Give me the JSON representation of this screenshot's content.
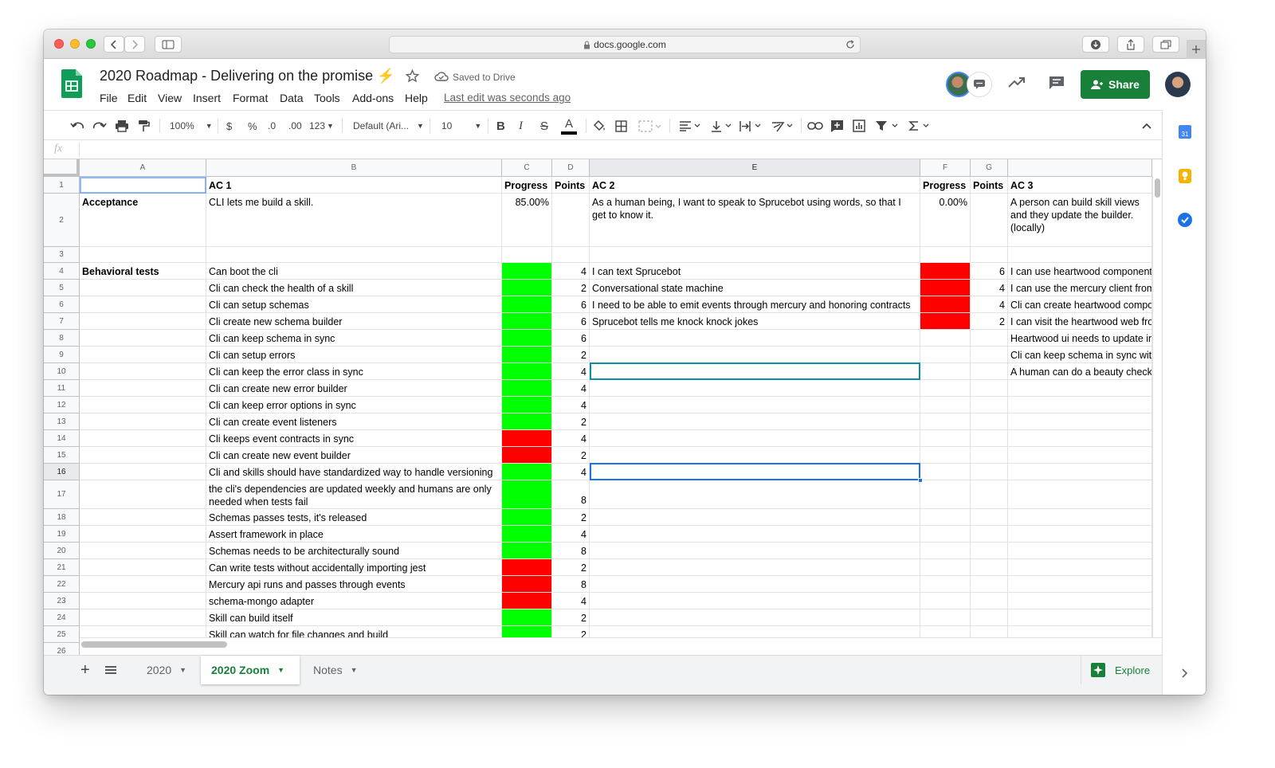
{
  "browser": {
    "url": "docs.google.com"
  },
  "doc": {
    "title": "2020 Roadmap - Delivering on the promise",
    "saved": "Saved to Drive",
    "last_edit": "Last edit was seconds ago",
    "share": "Share",
    "menus": [
      "File",
      "Edit",
      "View",
      "Insert",
      "Format",
      "Data",
      "Tools",
      "Add-ons",
      "Help"
    ]
  },
  "toolbar": {
    "zoom": "100%",
    "currency": "$",
    "percent": "%",
    "dec_minus": ".0",
    "dec_plus": ".00",
    "numfmt": "123",
    "font": "Default (Ari...",
    "size": "10",
    "bold": "B",
    "italic": "I",
    "strike": "S",
    "textcolor": "A"
  },
  "formula": {
    "fx": "fx"
  },
  "columns": [
    "A",
    "B",
    "C",
    "D",
    "E",
    "F",
    "G"
  ],
  "rows": [
    "1",
    "2",
    "3",
    "4",
    "5",
    "6",
    "7",
    "8",
    "9",
    "10",
    "11",
    "12",
    "13",
    "14",
    "15",
    "16",
    "17",
    "18",
    "19",
    "20",
    "21",
    "22",
    "23",
    "24",
    "25",
    "26"
  ],
  "sheet": {
    "header": {
      "b": "AC 1",
      "c": "Progress",
      "d": "Points",
      "e": "AC 2",
      "f": "Progress",
      "g": "Points",
      "h": "AC 3"
    },
    "acceptance": {
      "a": "Acceptance",
      "b": "CLI lets me build a skill.",
      "c": "85.00%",
      "e": "As a human being, I want to speak to Sprucebot using words, so that I get to know it.",
      "f": "0.00%",
      "h": "A person can build skill views and they update the builder. (locally)"
    },
    "behavioral_label": "Behavioral tests",
    "ac1": [
      {
        "text": "Can boot the cli",
        "points": "4",
        "status": "green"
      },
      {
        "text": "Cli can check the health of a skill",
        "points": "2",
        "status": "green"
      },
      {
        "text": "Cli can setup schemas",
        "points": "6",
        "status": "green"
      },
      {
        "text": "Cli create new schema builder",
        "points": "6",
        "status": "green"
      },
      {
        "text": "Cli can keep schema in sync",
        "points": "6",
        "status": "green"
      },
      {
        "text": "Cli can setup errors",
        "points": "2",
        "status": "green"
      },
      {
        "text": "Cli can keep the error class in sync",
        "points": "4",
        "status": "green"
      },
      {
        "text": "Cli can create new error builder",
        "points": "4",
        "status": "green"
      },
      {
        "text": "Cli can keep error options in sync",
        "points": "4",
        "status": "green"
      },
      {
        "text": "Cli can create event listeners",
        "points": "2",
        "status": "green"
      },
      {
        "text": "Cli keeps event contracts in sync",
        "points": "4",
        "status": "red"
      },
      {
        "text": "Cli can create new event builder",
        "points": "2",
        "status": "red"
      },
      {
        "text": "Cli and skills should have standardized way to handle versioning",
        "points": "4",
        "status": "green"
      },
      {
        "text": "the cli's dependencies are updated weekly and humans are only needed when tests fail",
        "points": "8",
        "status": "green"
      },
      {
        "text": "Schemas passes tests, it's released",
        "points": "2",
        "status": "green"
      },
      {
        "text": "Assert framework in place",
        "points": "4",
        "status": "green"
      },
      {
        "text": "Schemas needs to be architecturally sound",
        "points": "8",
        "status": "green"
      },
      {
        "text": "Can write tests without accidentally importing jest",
        "points": "2",
        "status": "red"
      },
      {
        "text": "Mercury api runs and passes through events",
        "points": "8",
        "status": "red"
      },
      {
        "text": "schema-mongo adapter",
        "points": "4",
        "status": "red"
      },
      {
        "text": "Skill can build itself",
        "points": "2",
        "status": "green"
      },
      {
        "text": "Skill can watch for file changes and build",
        "points": "2",
        "status": "green"
      }
    ],
    "ac2": [
      {
        "text": "I can text Sprucebot",
        "points": "6",
        "status": "red"
      },
      {
        "text": "Conversational state machine",
        "points": "4",
        "status": "red"
      },
      {
        "text": "I need to be able to emit events through mercury and honoring contracts",
        "points": "4",
        "status": "red"
      },
      {
        "text": "Sprucebot tells me knock knock jokes",
        "points": "2",
        "status": "red"
      }
    ],
    "ac3": [
      "I can use heartwood components",
      "I can use the mercury client from",
      "Cli can create heartwood components",
      "I can visit the heartwood web from",
      "Heartwood ui needs to update in",
      "Cli can keep schema in sync with",
      "A human can do a beauty check"
    ]
  },
  "tabs": [
    {
      "label": "2020"
    },
    {
      "label": "2020 Zoom"
    },
    {
      "label": "Notes"
    }
  ],
  "explore": "Explore",
  "colors": {
    "green": "#00ff00",
    "red": "#ff0000",
    "brand": "#188038"
  }
}
